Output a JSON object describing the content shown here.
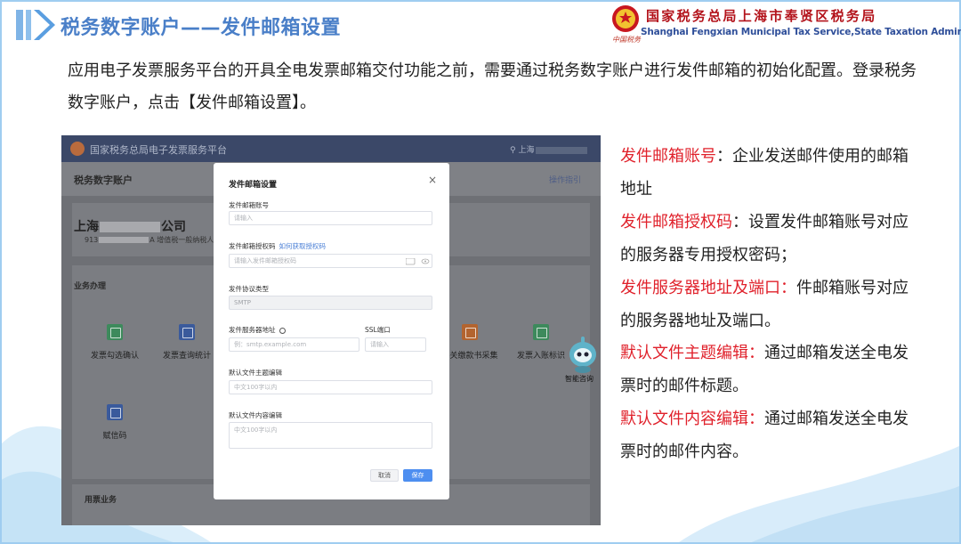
{
  "header": {
    "slide_title": "税务数字账户——发件邮箱设置",
    "bureau_cn": "国家税务总局上海市奉贤区税务局",
    "bureau_en": "Shanghai Fengxian Municipal Tax Service,State Taxation Administration",
    "brand_script": "中国税务"
  },
  "intro": "应用电子发票服务平台的开具全电发票邮箱交付功能之前，需要通过税务数字账户进行发件邮箱的初始化配置。登录税务数字账户，点击【发件邮箱设置】。",
  "screenshot": {
    "platform_name": "国家税务总局电子发票服务平台",
    "user_prefix": "上海",
    "account_title": "税务数字账户",
    "help_link": "操作指引",
    "company_prefix": "上海",
    "company_suffix": "公司",
    "company_sub_prefix": "913",
    "company_sub_suffix": "A  增值税一般纳税人",
    "business_title": "业务办理",
    "functions": [
      {
        "label": "发票勾选确认",
        "color": "#3d8a5c"
      },
      {
        "label": "发票查询统计",
        "color": "#3a5a9c"
      },
      {
        "label": "海关缴款书采集",
        "color": "#b3642f"
      },
      {
        "label": "发票入账标识",
        "color": "#3d8a5c"
      },
      {
        "label": "赋信码",
        "color": "#3a5a9c"
      }
    ],
    "used_title": "用票业务",
    "robot_label": "智能咨询"
  },
  "modal": {
    "title": "发件邮箱设置",
    "close": "×",
    "email_label": "发件邮箱账号",
    "email_placeholder": "请输入",
    "auth_label": "发件邮箱授权码",
    "auth_link": "如何获取授权码",
    "auth_placeholder": "请输入发件邮箱授权码",
    "protocol_label": "发件协议类型",
    "protocol_value": "SMTP",
    "server_label": "发件服务器地址",
    "server_placeholder": "例：smtp.example.com",
    "ssl_label": "SSL端口",
    "ssl_placeholder": "请输入",
    "subject_label": "默认文件主题编辑",
    "subject_placeholder": "中文100字以内",
    "content_label": "默认文件内容编辑",
    "content_placeholder": "中文100字以内",
    "cancel": "取消",
    "save": "保存"
  },
  "explain": [
    {
      "term": "发件邮箱账号",
      "desc": "：企业发送邮件使用的邮箱地址"
    },
    {
      "term": "发件邮箱授权码",
      "desc": "：设置发件邮箱账号对应的服务器专用授权密码；"
    },
    {
      "term": "发件服务器地址及端口：",
      "desc": "件邮箱账号对应的服务器地址及端口。"
    },
    {
      "term": "默认文件主题编辑：",
      "desc": "通过邮箱发送全电发票时的邮件标题。"
    },
    {
      "term": "默认文件内容编辑：",
      "desc": "通过邮箱发送全电发票时的邮件内容。"
    }
  ]
}
